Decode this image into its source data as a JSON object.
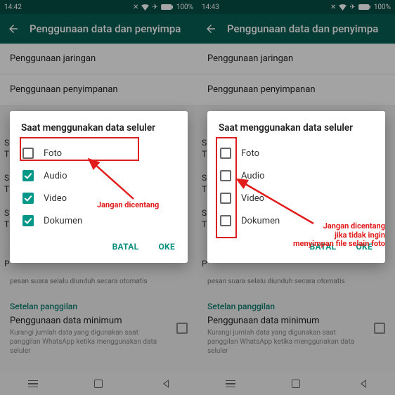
{
  "left": {
    "statusbar": {
      "time": "14:42",
      "battery": "100%"
    },
    "appbar": {
      "title": "Penggunaan data dan penyimpa"
    },
    "list": {
      "item1": "Penggunaan jaringan",
      "item2": "Penggunaan penyimpanan"
    },
    "note": "pesan suara selalu diunduh secara otomatis",
    "call_section": "Setelan panggilan",
    "min_title": "Penggunaan data minimum",
    "min_desc": "Kurangi jumlah data yang digunakan saat panggilan WhatsApp ketika menggunakan data seluler",
    "dialog": {
      "title": "Saat menggunakan data seluler",
      "options": [
        {
          "label": "Foto",
          "checked": false
        },
        {
          "label": "Audio",
          "checked": true
        },
        {
          "label": "Video",
          "checked": true
        },
        {
          "label": "Dokumen",
          "checked": true
        }
      ],
      "cancel": "BATAL",
      "ok": "OKE"
    },
    "annotation": "Jangan dicentang"
  },
  "right": {
    "statusbar": {
      "time": "14:43",
      "battery": "100%"
    },
    "appbar": {
      "title": "Penggunaan data dan penyimpa"
    },
    "list": {
      "item1": "Penggunaan jaringan",
      "item2": "Penggunaan penyimpanan"
    },
    "note": "pesan suara selalu diunduh secara otomatis",
    "call_section": "Setelan panggilan",
    "min_title": "Penggunaan data minimum",
    "min_desc": "Kurangi jumlah data yang digunakan saat panggilan WhatsApp ketika menggunakan data seluler",
    "dialog": {
      "title": "Saat menggunakan data seluler",
      "options": [
        {
          "label": "Foto",
          "checked": false
        },
        {
          "label": "Audio",
          "checked": false
        },
        {
          "label": "Video",
          "checked": false
        },
        {
          "label": "Dokumen",
          "checked": false
        }
      ],
      "cancel": "BATAL",
      "ok": "OKE"
    },
    "annotation_l1": "Jangan dicentang",
    "annotation_l2": "jika tidak ingin",
    "annotation_l3": "menyimpan file selain foto"
  },
  "peek": {
    "s": "S",
    "t": "T",
    "p": "P"
  }
}
